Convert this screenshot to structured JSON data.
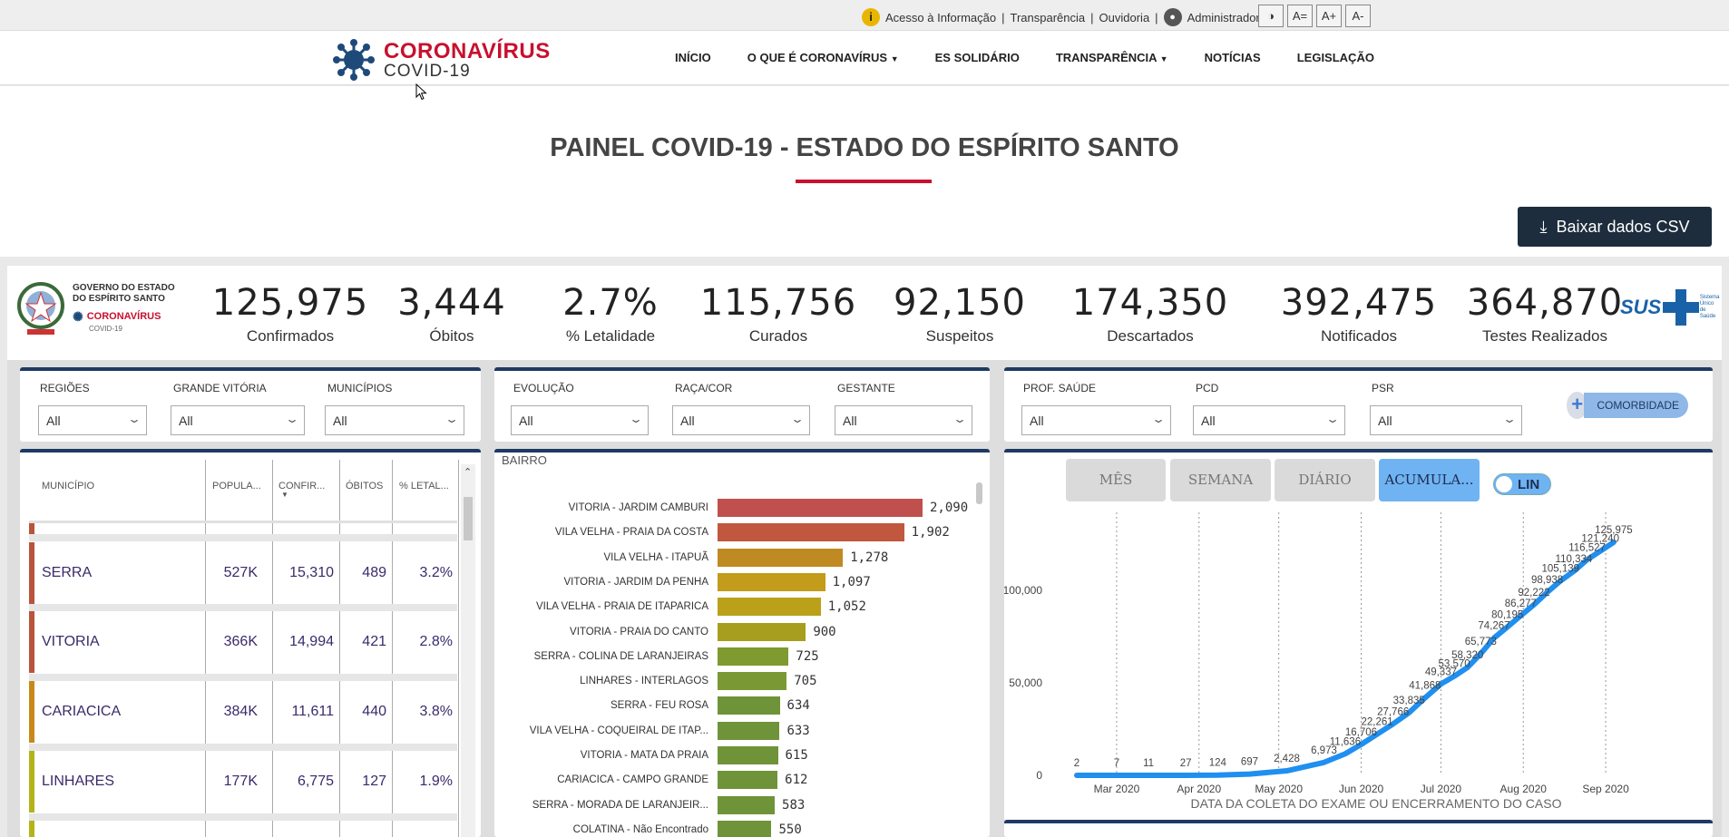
{
  "topbar": {
    "links": [
      "Acesso à Informação",
      "Transparência",
      "Ouvidoria",
      "Administrador"
    ],
    "access_buttons": [
      "A=",
      "A+",
      "A-"
    ]
  },
  "header": {
    "brand_line1": "CORONAVÍRUS",
    "brand_line2": "COVID-19",
    "nav": [
      "INÍCIO",
      "O QUE É CORONAVÍRUS",
      "ES SOLIDÁRIO",
      "TRANSPARÊNCIA",
      "NOTÍCIAS",
      "LEGISLAÇÃO"
    ]
  },
  "page": {
    "title": "PAINEL COVID-19 - ESTADO DO ESPÍRITO SANTO",
    "csv_button": "Baixar dados CSV"
  },
  "gov": {
    "line1": "GOVERNO DO ESTADO",
    "line2": "DO ESPÍRITO SANTO",
    "corona": "CORONAVÍRUS",
    "covid": "COVID-19"
  },
  "kpis": [
    {
      "value": "125,975",
      "label": "Confirmados"
    },
    {
      "value": "3,444",
      "label": "Óbitos"
    },
    {
      "value": "2.7%",
      "label": "% Letalidade"
    },
    {
      "value": "115,756",
      "label": "Curados"
    },
    {
      "value": "92,150",
      "label": "Suspeitos"
    },
    {
      "value": "174,350",
      "label": "Descartados"
    },
    {
      "value": "392,475",
      "label": "Notificados"
    },
    {
      "value": "364,870",
      "label": "Testes Realizados"
    }
  ],
  "sus": {
    "text": "SUS",
    "small1": "Sistema",
    "small2": "Único",
    "small3": "de Saúde"
  },
  "filters": {
    "group1": [
      {
        "label": "REGIÕES",
        "value": "All"
      },
      {
        "label": "GRANDE VITÓRIA",
        "value": "All"
      },
      {
        "label": "MUNICÍPIOS",
        "value": "All"
      }
    ],
    "group2": [
      {
        "label": "EVOLUÇÃO",
        "value": "All"
      },
      {
        "label": "RAÇA/COR",
        "value": "All"
      },
      {
        "label": "GESTANTE",
        "value": "All"
      }
    ],
    "group3": [
      {
        "label": "PROF. SAÚDE",
        "value": "All"
      },
      {
        "label": "PCD",
        "value": "All"
      },
      {
        "label": "PSR",
        "value": "All"
      }
    ],
    "comorbidade": "COMORBIDADE"
  },
  "table": {
    "columns": [
      "MUNICÍPIO",
      "POPULA...",
      "CONFIR...",
      "ÓBITOS",
      "% LETAL..."
    ],
    "rows": [
      {
        "name": "SERRA",
        "pop": "527K",
        "conf": "15,310",
        "obitos": "489",
        "letal": "3.2%",
        "color": "#b9533c"
      },
      {
        "name": "VITORIA",
        "pop": "366K",
        "conf": "14,994",
        "obitos": "421",
        "letal": "2.8%",
        "color": "#b9533c"
      },
      {
        "name": "CARIACICA",
        "pop": "384K",
        "conf": "11,611",
        "obitos": "440",
        "letal": "3.8%",
        "color": "#c8891a"
      },
      {
        "name": "LINHARES",
        "pop": "177K",
        "conf": "6,775",
        "obitos": "127",
        "letal": "1.9%",
        "color": "#b3b31a"
      }
    ]
  },
  "bairro_chart": {
    "label": "BAIRRO",
    "items": [
      {
        "name": "VITORIA - JARDIM CAMBURI",
        "value": 2090,
        "label": "2,090",
        "color": "#c0504d"
      },
      {
        "name": "VILA VELHA - PRAIA DA COSTA",
        "value": 1902,
        "label": "1,902",
        "color": "#c0573e"
      },
      {
        "name": "VILA VELHA - ITAPUÃ",
        "value": 1278,
        "label": "1,278",
        "color": "#c08a22"
      },
      {
        "name": "VITORIA - JARDIM DA PENHA",
        "value": 1097,
        "label": "1,097",
        "color": "#c29c1a"
      },
      {
        "name": "VILA VELHA - PRAIA DE ITAPARICA",
        "value": 1052,
        "label": "1,052",
        "color": "#bba019"
      },
      {
        "name": "VITORIA - PRAIA DO CANTO",
        "value": 900,
        "label": "900",
        "color": "#a79e20"
      },
      {
        "name": "SERRA - COLINA DE LARANJEIRAS",
        "value": 725,
        "label": "725",
        "color": "#7f9a2f"
      },
      {
        "name": "LINHARES - INTERLAGOS",
        "value": 705,
        "label": "705",
        "color": "#7a9934"
      },
      {
        "name": "SERRA - FEU ROSA",
        "value": 634,
        "label": "634",
        "color": "#6f9338"
      },
      {
        "name": "VILA VELHA - COQUEIRAL DE ITAP...",
        "value": 633,
        "label": "633",
        "color": "#6f9338"
      },
      {
        "name": "VITORIA - MATA DA PRAIA",
        "value": 615,
        "label": "615",
        "color": "#6f9338"
      },
      {
        "name": "CARIACICA - CAMPO GRANDE",
        "value": 612,
        "label": "612",
        "color": "#6f9338"
      },
      {
        "name": "SERRA - MORADA DE LARANJEIR...",
        "value": 583,
        "label": "583",
        "color": "#6f9338"
      },
      {
        "name": "COLATINA - Não Encontrado",
        "value": 550,
        "label": "550",
        "color": "#6f9338"
      }
    ]
  },
  "timeline": {
    "buttons": [
      "MÊS",
      "SEMANA",
      "DIÁRIO",
      "ACUMULA..."
    ],
    "toggle": "LIN",
    "xlabel": "DATA DA COLETA DO EXAME OU ENCERRAMENTO DO CASO",
    "yticks": [
      "100,000",
      "50,000",
      "0"
    ],
    "xticks": [
      "Mar 2020",
      "Apr 2020",
      "May 2020",
      "Jun 2020",
      "Jul 2020",
      "Aug 2020",
      "Sep 2020"
    ]
  },
  "chart_data": {
    "type": "line",
    "title": "",
    "xlabel": "DATA DA COLETA DO EXAME OU ENCERRAMENTO DO CASO",
    "ylabel": "",
    "ylim": [
      0,
      130000
    ],
    "x": [
      "2020-02-15",
      "2020-03-01",
      "2020-03-13",
      "2020-03-27",
      "2020-04-08",
      "2020-04-20",
      "2020-05-04",
      "2020-05-18",
      "2020-05-26",
      "2020-06-01",
      "2020-06-07",
      "2020-06-13",
      "2020-06-19",
      "2020-06-25",
      "2020-07-01",
      "2020-07-06",
      "2020-07-11",
      "2020-07-16",
      "2020-07-21",
      "2020-07-26",
      "2020-07-31",
      "2020-08-05",
      "2020-08-10",
      "2020-08-15",
      "2020-08-20",
      "2020-08-25",
      "2020-08-30",
      "2020-09-04",
      "2020-09-10",
      "2020-09-17",
      "2020-09-24"
    ],
    "series": [
      {
        "values": [
          2,
          7,
          11,
          27,
          124,
          697,
          2428,
          6973,
          11636,
          16706,
          22261,
          27766,
          33835,
          41868,
          49337,
          53570,
          58320,
          65773,
          74267,
          80195,
          86277,
          92222,
          98938,
          105139,
          110334,
          116527,
          121240,
          125975
        ]
      }
    ],
    "labels": [
      "2",
      "7",
      "11",
      "27",
      "124",
      "697",
      "2,428",
      "6,973",
      "11,636",
      "16,706",
      "22,261",
      "27,766",
      "33,835",
      "41,868",
      "49,337",
      "53,570",
      "58,320",
      "65,773",
      "74,267",
      "80,195",
      "86,277",
      "92,222",
      "98,938",
      "105,139",
      "110,334",
      "116,527",
      "121,240",
      "125,975"
    ],
    "grid": true
  }
}
